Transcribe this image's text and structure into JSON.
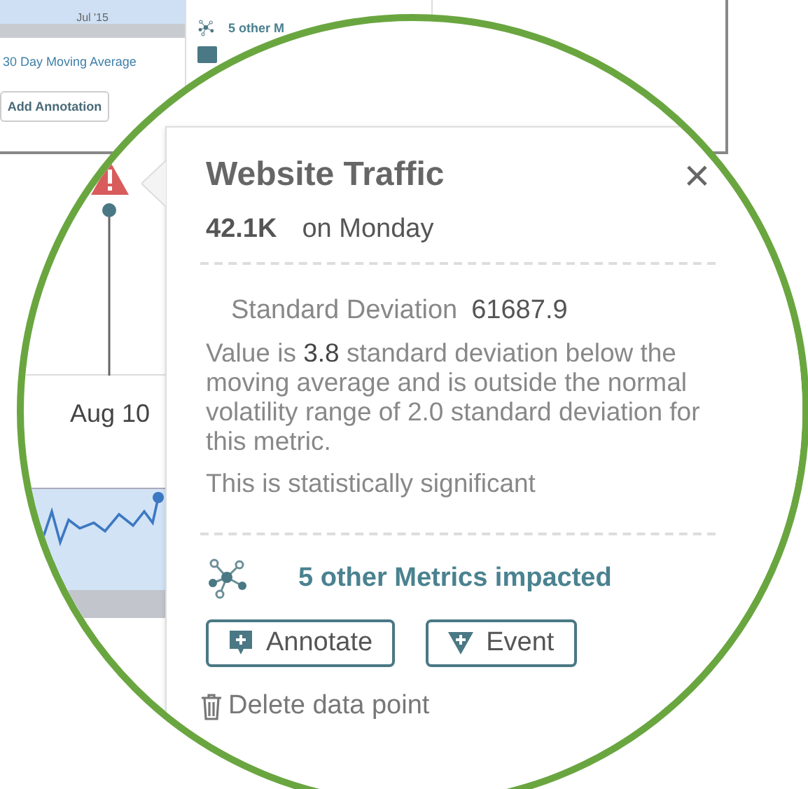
{
  "background": {
    "axis_label": "Jul '15",
    "legend": "30 Day Moving Average",
    "add_button": "Add Annotation",
    "impact_text": "5 other M"
  },
  "lens": {
    "date_label": "Aug 10"
  },
  "popover": {
    "title": "Website Traffic",
    "close": "×",
    "value": "42.1K",
    "day": "on Monday",
    "deviation_label": "Standard Deviation",
    "deviation_value": "61687.9",
    "explanation": "Value is **3.8** standard deviation below the moving average and is outside the normal volatility range of 2.0 standard deviation for this metric.",
    "significance": "This is statistically significant",
    "impact": "5 other Metrics impacted",
    "buttons": [
      {
        "label": "Annotate",
        "kind": "annotate"
      },
      {
        "label": "Event",
        "kind": "event"
      }
    ],
    "delete": "Delete data point"
  }
}
